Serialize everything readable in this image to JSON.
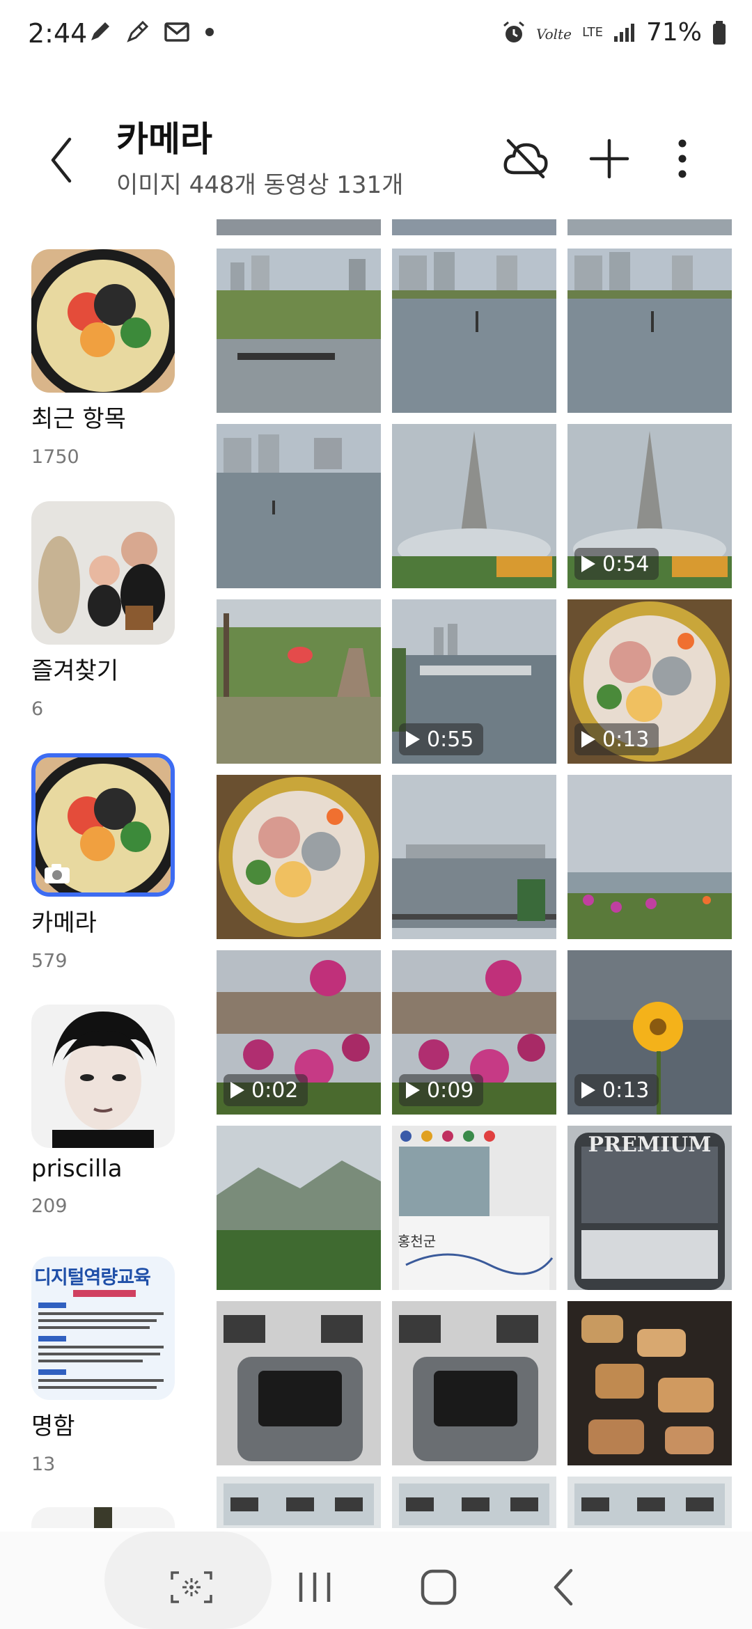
{
  "status_bar": {
    "time": "2:44",
    "network": "LTE",
    "battery": "71%",
    "icons": [
      "pen-icon",
      "pen-outline-icon",
      "mail-icon",
      "dot-icon",
      "alarm-icon",
      "volte-icon",
      "signal-icon",
      "battery-icon"
    ]
  },
  "header": {
    "title": "카메라",
    "subtitle": "이미지 448개 동영상 131개",
    "buttons": [
      "back-icon",
      "cloud-off-icon",
      "plus-icon",
      "more-icon"
    ]
  },
  "albums": [
    {
      "name": "최근 항목",
      "count": "1750",
      "thumb": "noodle-soup"
    },
    {
      "name": "즐겨찾기",
      "count": "6",
      "thumb": "figurines"
    },
    {
      "name": "카메라",
      "count": "579",
      "thumb": "noodle-soup",
      "selected": true
    },
    {
      "name": "priscilla",
      "count": "209",
      "thumb": "portrait"
    },
    {
      "name": "명함",
      "count": "13",
      "thumb": "poster",
      "poster_text": "디지털역량교육"
    }
  ],
  "grid": {
    "items": [
      {
        "type": "waterfront",
        "video": false
      },
      {
        "type": "lake",
        "video": false
      },
      {
        "type": "lake",
        "video": false
      },
      {
        "type": "lake-city",
        "video": false
      },
      {
        "type": "fountain",
        "video": false
      },
      {
        "type": "fountain",
        "video": true,
        "duration": "0:54"
      },
      {
        "type": "park-path",
        "video": false
      },
      {
        "type": "marina",
        "video": true,
        "duration": "0:55"
      },
      {
        "type": "food-plate",
        "video": true,
        "duration": "0:13"
      },
      {
        "type": "food-plate",
        "video": false
      },
      {
        "type": "city-view",
        "video": false
      },
      {
        "type": "flowers-shore",
        "video": false
      },
      {
        "type": "petunias",
        "video": true,
        "duration": "0:02"
      },
      {
        "type": "petunias",
        "video": true,
        "duration": "0:09"
      },
      {
        "type": "yellow-flower",
        "video": true,
        "duration": "0:13"
      },
      {
        "type": "mountains",
        "video": false
      },
      {
        "type": "sign-board",
        "video": false,
        "label": "홍천군"
      },
      {
        "type": "bus",
        "video": false,
        "label": "PREMIUM"
      },
      {
        "type": "bus-seat",
        "video": false
      },
      {
        "type": "bus-seat",
        "video": false
      },
      {
        "type": "food-grill",
        "video": false
      },
      {
        "type": "office",
        "video": false
      },
      {
        "type": "office",
        "video": false
      },
      {
        "type": "office",
        "video": false
      }
    ]
  },
  "nav": {
    "buttons": [
      "focus-icon",
      "recents-icon",
      "home-icon",
      "back-icon"
    ]
  },
  "colors": {
    "accent": "#3d6cf2"
  }
}
